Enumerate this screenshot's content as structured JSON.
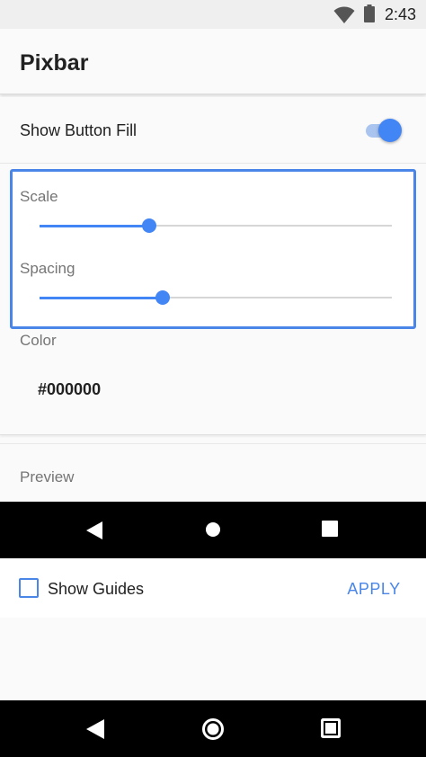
{
  "status_bar": {
    "time": "2:43",
    "icons": [
      "wifi-icon",
      "battery-icon"
    ]
  },
  "app_bar": {
    "title": "Pixbar"
  },
  "settings": {
    "show_button_fill": {
      "label": "Show Button Fill",
      "checked": true
    },
    "scale": {
      "label": "Scale",
      "value_fraction": 0.31
    },
    "spacing": {
      "label": "Spacing",
      "value_fraction": 0.35
    },
    "color": {
      "label": "Color",
      "value": "#000000"
    },
    "preview": {
      "label": "Preview"
    }
  },
  "preview_nav_bar": {
    "buttons": [
      "back-icon",
      "home-icon",
      "recents-icon"
    ]
  },
  "footer": {
    "show_guides_label": "Show Guides",
    "show_guides_checked": false,
    "apply_label": "APPLY"
  },
  "system_nav_bar": {
    "buttons": [
      "back-icon",
      "home-icon",
      "recents-icon"
    ]
  },
  "colors": {
    "accent": "#4285f4",
    "focus_border": "#4a86e8",
    "switch_track": "#a9c4ee",
    "navbar": "#000000"
  }
}
